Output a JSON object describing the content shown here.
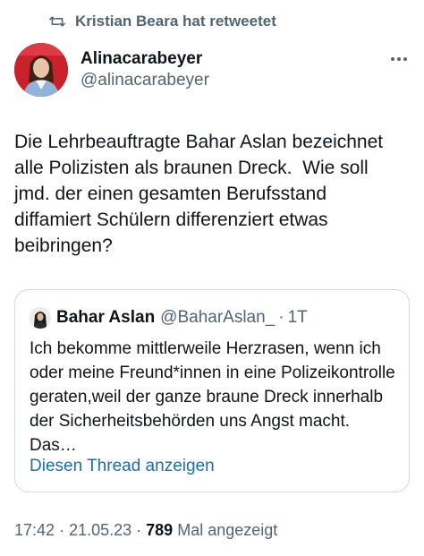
{
  "retweet": {
    "icon": "retweet-icon",
    "label": "Kristian Beara hat retweetet"
  },
  "tweet": {
    "display_name": "Alinacarabeyer",
    "handle": "@alinacarabeyer",
    "more_icon": "ellipsis-icon",
    "text": "Die Lehrbeauftragte Bahar Aslan bezeichnet alle Polizisten als braunen Dreck.  Wie soll jmd. der einen gesamten Berufsstand diffamiert Schülern differenziert etwas beibringen?",
    "time": "17:42",
    "date": "21.05.23",
    "views_count": "789",
    "views_label": "Mal angezeigt"
  },
  "quoted": {
    "display_name": "Bahar Aslan",
    "handle": "@BaharAslan_",
    "dot": "·",
    "time": "1T",
    "text": "Ich bekomme mittlerweile Herzrasen, wenn ich oder meine Freund*innen in eine Polizeikontrolle geraten,weil der ganze braune Dreck innerhalb der Sicherheitsbehörden uns Angst macht. Das…",
    "show_thread": "Diesen Thread anzeigen"
  },
  "colors": {
    "text_primary": "#0f1419",
    "text_secondary": "#536471",
    "link": "#1d6fa5",
    "border": "#cfd9de",
    "avatar_background": "#c8232c"
  }
}
